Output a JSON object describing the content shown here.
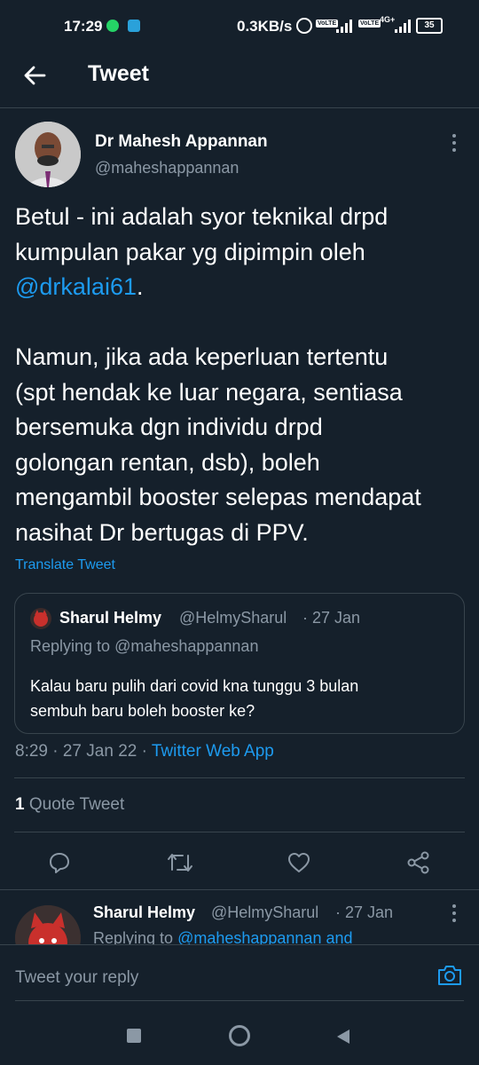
{
  "status_bar": {
    "time": "17:29",
    "net_speed": "0.3KB/s",
    "sim1": "VoLTE",
    "sim2": "VoLTE",
    "net_type": "4G+",
    "battery": "35"
  },
  "header": {
    "title": "Tweet"
  },
  "tweet": {
    "author_name": "Dr Mahesh Appannan",
    "author_handle": "@maheshappannan",
    "body_line1": "Betul - ini adalah syor teknikal drpd",
    "body_line2": "kumpulan pakar yg dipimpin oleh",
    "body_mention": "@drkalai61",
    "body_mention_suffix": ".",
    "body_p2_line1": "Namun, jika ada keperluan tertentu",
    "body_p2_line2": "(spt hendak ke luar negara, sentiasa",
    "body_p2_line3": "bersemuka dgn individu drpd",
    "body_p2_line4": "golongan rentan, dsb), boleh",
    "body_p2_line5": "mengambil booster selepas mendapat",
    "body_p2_line6": "nasihat Dr bertugas di PPV.",
    "translate": "Translate Tweet",
    "quoted": {
      "name": "Sharul Helmy",
      "handle": "@HelmySharul",
      "date": "· 27 Jan",
      "replying_prefix": "Replying to ",
      "replying_handle": "@maheshappannan",
      "text_line1": "Kalau baru pulih dari covid kna tunggu 3 bulan",
      "text_line2": "sembuh baru boleh booster ke?"
    },
    "timestamp": "8:29 · 27 Jan 22 · ",
    "source": "Twitter Web App",
    "quote_count": "1",
    "quote_label": " Quote Tweet"
  },
  "reply": {
    "name": "Sharul Helmy",
    "handle": "@HelmySharul",
    "date": "· 27 Jan",
    "replying_prefix": "Replying to ",
    "replying_handle": "@maheshappannan and"
  },
  "composer": {
    "placeholder": "Tweet your reply"
  },
  "icons": {
    "back": "arrow-left-icon",
    "more": "more-vertical-icon",
    "reply": "reply-icon",
    "retweet": "retweet-icon",
    "like": "heart-icon",
    "share": "share-icon",
    "camera": "camera-icon"
  },
  "colors": {
    "background": "#15202b",
    "accent": "#1d9bf0",
    "muted": "#8b98a5",
    "divider": "#38444d"
  }
}
